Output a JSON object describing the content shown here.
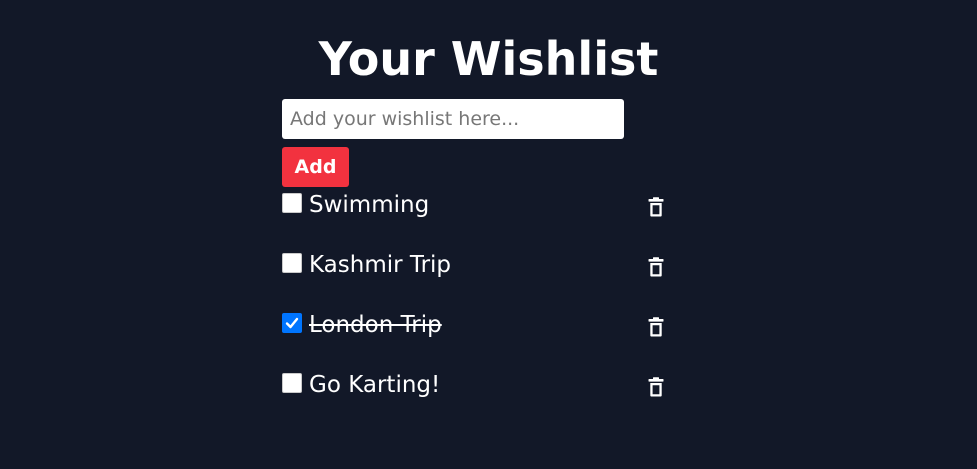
{
  "header": {
    "title": "Your Wishlist"
  },
  "form": {
    "placeholder": "Add your wishlist here...",
    "add_label": "Add"
  },
  "items": [
    {
      "label": "Swimming",
      "checked": false
    },
    {
      "label": "Kashmir Trip",
      "checked": false
    },
    {
      "label": "London Trip",
      "checked": true
    },
    {
      "label": "Go Karting!",
      "checked": false
    }
  ],
  "colors": {
    "background": "#121828",
    "accent": "#f2323f",
    "check": "#0075ff"
  },
  "icons": {
    "delete": "trash-icon"
  }
}
